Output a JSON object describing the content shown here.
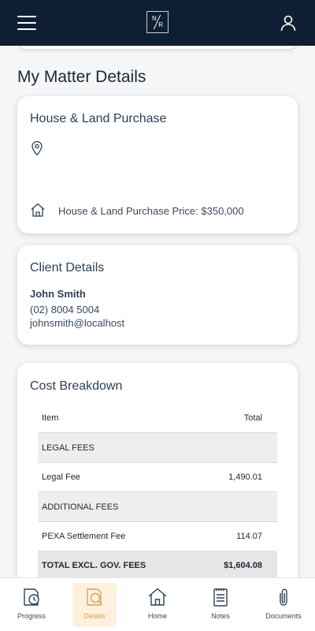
{
  "header": {
    "logo_letters": [
      "N",
      "R"
    ]
  },
  "page": {
    "title": "My Matter Details"
  },
  "property": {
    "title": "House & Land Purchase",
    "price_line": "House & Land Purchase Price: $350,000"
  },
  "client": {
    "title": "Client Details",
    "name": "John Smith",
    "phone": "(02) 8004 5004",
    "email": "johnsmith@localhost"
  },
  "costs": {
    "title": "Cost Breakdown",
    "columns": [
      "Item",
      "Total"
    ],
    "rows": [
      {
        "type": "section",
        "label": "LEGAL FEES",
        "value": ""
      },
      {
        "type": "item",
        "label": "Legal Fee",
        "value": "1,490.01"
      },
      {
        "type": "section",
        "label": "ADDITIONAL FEES",
        "value": ""
      },
      {
        "type": "item",
        "label": "PEXA Settlement Fee",
        "value": "114.07"
      },
      {
        "type": "total",
        "label": "TOTAL EXCL. GOV. FEES",
        "value": "$1,604.08"
      }
    ]
  },
  "nav": {
    "items": [
      {
        "label": "Progress",
        "icon": "progress-icon",
        "active": false
      },
      {
        "label": "Details",
        "icon": "details-icon",
        "active": true
      },
      {
        "label": "Home",
        "icon": "home-icon",
        "active": false
      },
      {
        "label": "Notes",
        "icon": "notes-icon",
        "active": false
      },
      {
        "label": "Documents",
        "icon": "paperclip-icon",
        "active": false
      }
    ]
  },
  "colors": {
    "header_bg": "#0f1f33",
    "accent": "#d3a35c",
    "active_tab_bg": "#fdf1de",
    "icon_stroke": "#2e4056"
  }
}
